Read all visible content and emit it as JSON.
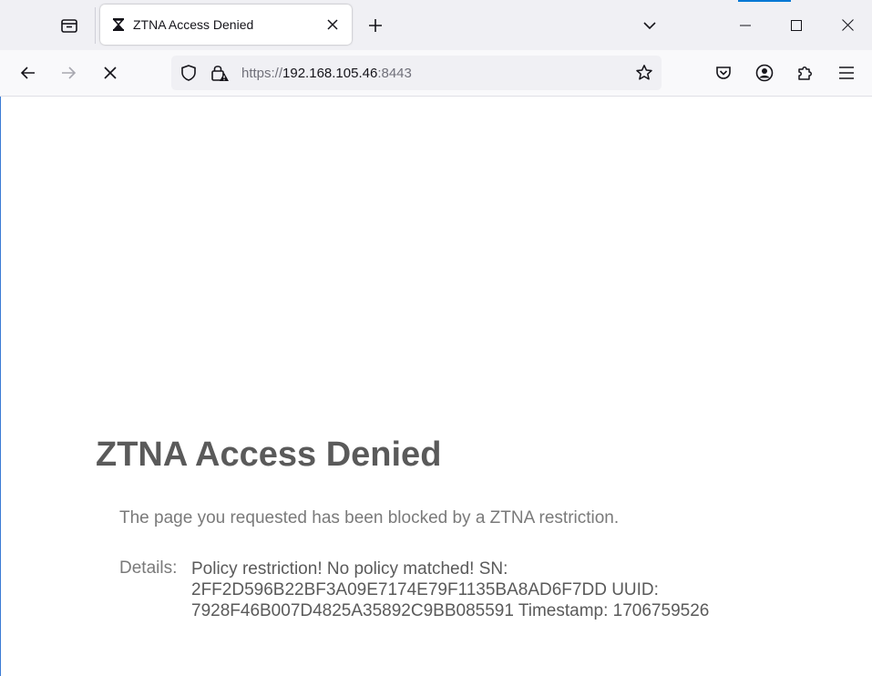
{
  "tab": {
    "title": "ZTNA Access Denied"
  },
  "url": {
    "scheme": "https://",
    "host": "192.168.105.46",
    "port": ":8443"
  },
  "page": {
    "heading": "ZTNA Access Denied",
    "message": "The page you requested has been blocked by a ZTNA restriction.",
    "details_label": "Details:",
    "details_lines": [
      "Policy restriction! No policy matched! SN:",
      "2FF2D596B22BF3A09E7174E79F1135BA8AD6F7DD UUID:",
      "7928F46B007D4825A35892C9BB085591 Timestamp: 1706759526"
    ]
  },
  "icons": {
    "tab_list": "tab-list-icon",
    "favicon": "hourglass-icon",
    "tab_close": "close-icon",
    "new_tab": "plus-icon",
    "list_all_tabs": "chevron-down-icon",
    "minimize": "minimize-icon",
    "maximize": "maximize-icon",
    "close_window": "close-icon",
    "back": "arrow-left-icon",
    "forward": "arrow-right-icon",
    "stop": "stop-icon",
    "tracking_protection": "shield-icon",
    "site_security": "lock-warning-icon",
    "bookmark": "star-icon",
    "pocket": "pocket-icon",
    "account": "account-icon",
    "extensions": "puzzle-icon",
    "menu": "hamburger-menu-icon"
  },
  "colors": {
    "accent": "#0078d4",
    "heading": "#5a5a5a",
    "body_text": "#7a7a7a",
    "tabbar_bg": "#f0f0f4",
    "navbar_bg": "#f9f9fb"
  }
}
